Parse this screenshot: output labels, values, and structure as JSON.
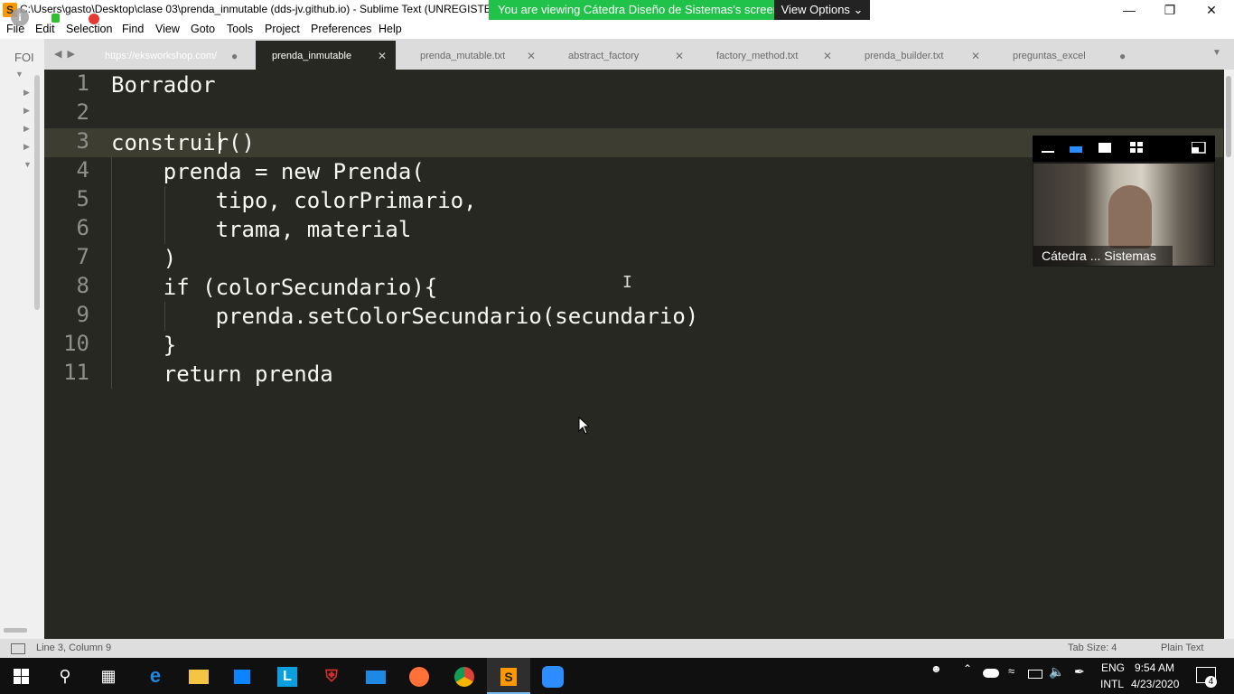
{
  "window": {
    "title": "C:\\Users\\gasto\\Desktop\\clase 03\\prenda_inmutable (dds-jv.github.io) - Sublime Text (UNREGISTERED)",
    "app_icon": "S"
  },
  "zoom": {
    "banner": "You are viewing Cátedra Diseño de Sistemas's screen",
    "view_options": "View Options ⌄",
    "participant_label": "Cátedra ... Sistemas"
  },
  "menu": [
    "File",
    "Edit",
    "Selection",
    "Find",
    "View",
    "Goto",
    "Tools",
    "Project",
    "Preferences",
    "Help"
  ],
  "sidebar": {
    "label": "FOI"
  },
  "tabs": [
    {
      "label": "https://eksworkshop.com/",
      "close": "●"
    },
    {
      "label": "prenda_inmutable",
      "close": "✕"
    },
    {
      "label": "prenda_mutable.txt",
      "close": "✕"
    },
    {
      "label": "abstract_factory",
      "close": "✕"
    },
    {
      "label": "factory_method.txt",
      "close": "✕"
    },
    {
      "label": "prenda_builder.txt",
      "close": "✕"
    },
    {
      "label": "preguntas_excel",
      "close": "●"
    }
  ],
  "editor": {
    "lines": [
      "Borrador",
      "",
      "construir()",
      "    prenda = new Prenda(",
      "        tipo, colorPrimario,",
      "        trama, material",
      "    )",
      "    if (colorSecundario){",
      "        prenda.setColorSecundario(secundario)",
      "    }",
      "    return prenda"
    ],
    "line_numbers": [
      "1",
      "2",
      "3",
      "4",
      "5",
      "6",
      "7",
      "8",
      "9",
      "10",
      "11"
    ]
  },
  "status": {
    "position": "Line 3, Column 9",
    "tab_size": "Tab Size: 4",
    "syntax": "Plain Text"
  },
  "taskbar": {
    "lang_top": "ENG",
    "lang_bottom": "INTL",
    "time": "9:54 AM",
    "date": "4/23/2020",
    "notifications": "4"
  },
  "colors": {
    "editor_bg": "#272822",
    "zoom_green": "#21c24a",
    "sublime_orange": "#ff9800"
  }
}
